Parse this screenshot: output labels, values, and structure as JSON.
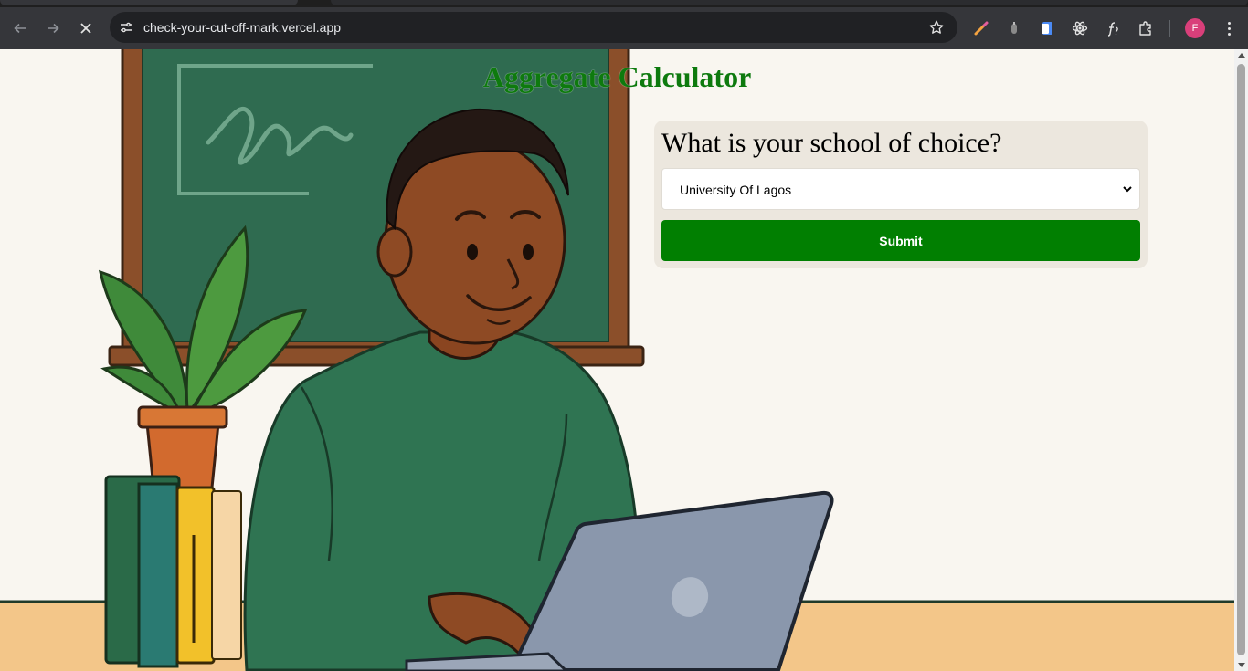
{
  "browser": {
    "url": "check-your-cut-off-mark.vercel.app",
    "profile_initial": "F",
    "profile_color": "#d93f7a",
    "icons": [
      "back-arrow-icon",
      "forward-arrow-icon",
      "stop-loading-icon",
      "site-settings-icon",
      "bookmark-star-icon",
      "brush-extension-icon",
      "ink-extension-icon",
      "docs-extension-icon",
      "react-devtools-icon",
      "formula-extension-icon",
      "extensions-puzzle-icon",
      "menu-dots-icon"
    ]
  },
  "page": {
    "title": "Aggregate Calculator",
    "form": {
      "question": "What is your school of choice?",
      "selected_school": "University Of Lagos",
      "submit_label": "Submit"
    }
  },
  "colors": {
    "title_green": "#0e7a0e",
    "submit_green": "#017f01",
    "background": "#f9f6f0",
    "card": "#ece7de"
  }
}
